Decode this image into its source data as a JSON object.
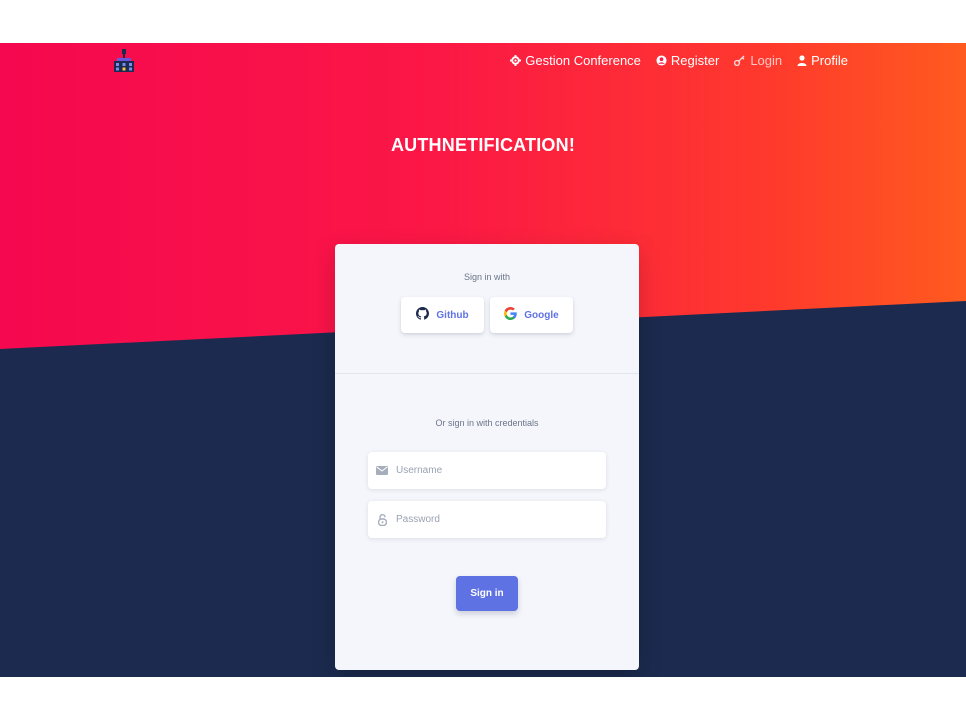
{
  "navbar": {
    "logo_icon": "conference-building-icon",
    "links": [
      {
        "label": "Gestion Conference",
        "icon": "settings-icon"
      },
      {
        "label": "Register",
        "icon": "user-circle-icon"
      },
      {
        "label": "Login",
        "icon": "key-icon"
      },
      {
        "label": "Profile",
        "icon": "person-icon"
      }
    ]
  },
  "hero": {
    "title": "AUTHNETIFICATION!"
  },
  "auth_card": {
    "sign_in_with": "Sign in with",
    "github_label": "Github",
    "google_label": "Google",
    "credentials_text": "Or sign in with credentials",
    "username_placeholder": "Username",
    "username_value": "",
    "password_placeholder": "Password",
    "password_value": "",
    "submit_label": "Sign in"
  },
  "colors": {
    "hero_gradient_start": "#f5084f",
    "hero_gradient_end": "#ff5b1f",
    "page_background": "#1b2a4e",
    "primary": "#5e72e4",
    "card_background": "#f4f6fb"
  }
}
